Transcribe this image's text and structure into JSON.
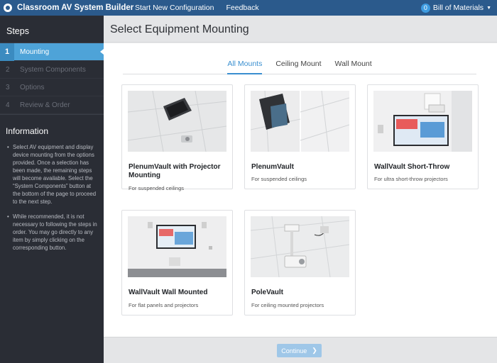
{
  "app": {
    "title": "Classroom AV System Builder",
    "nav": [
      "Start New Configuration",
      "Feedback"
    ],
    "bom_count": "0",
    "bom_label": "Bill of Materials"
  },
  "sidebar": {
    "title": "Steps",
    "steps": [
      {
        "num": "1",
        "label": "Mounting"
      },
      {
        "num": "2",
        "label": "System Components"
      },
      {
        "num": "3",
        "label": "Options"
      },
      {
        "num": "4",
        "label": "Review & Order"
      }
    ],
    "info_title": "Information",
    "info_items": [
      "Select AV equipment and display device mounting from the options provided. Once a selection has been made, the remaining steps will become available. Select the “System Components” button at the bottom of the page to proceed to the next step.",
      "While recommended, it is not necessary to following the steps in order. You may go directly to any item by simply clicking on the corresponding button."
    ]
  },
  "page": {
    "title": "Select Equipment Mounting",
    "tabs": [
      "All Mounts",
      "Ceiling Mount",
      "Wall Mount"
    ]
  },
  "cards": [
    {
      "name": "PlenumVault with Projector Mounting",
      "desc": "For suspended ceilings"
    },
    {
      "name": "PlenumVault",
      "desc": "For suspended ceilings"
    },
    {
      "name": "WallVault Short-Throw",
      "desc": "For ultra short-throw projectors"
    },
    {
      "name": "WallVault Wall Mounted",
      "desc": "For flat panels and projectors"
    },
    {
      "name": "PoleVault",
      "desc": "For ceiling mounted projectors"
    }
  ],
  "footer": {
    "continue_label": "Continue"
  },
  "colors": {
    "topbar": "#2b5a8c",
    "accent": "#4ea3d8",
    "sidebar": "#2a2d35"
  }
}
